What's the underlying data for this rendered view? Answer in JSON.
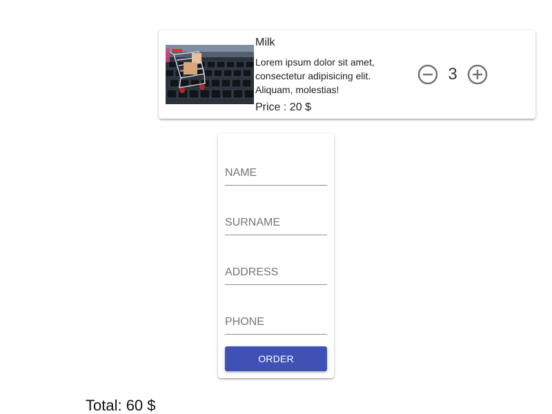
{
  "cart": {
    "items": [
      {
        "name": "Milk",
        "description": "Lorem ipsum dolor sit amet, consectetur adipisicing elit. Aliquam, molestias!",
        "price_text": "Price : 20 $",
        "quantity": "3",
        "image_icon": "shopping-cart-on-laptop-keyboard-image"
      }
    ],
    "minus_icon": "minus-circle-icon",
    "plus_icon": "plus-circle-icon"
  },
  "form": {
    "name_placeholder": "NAME",
    "surname_placeholder": "SURNAME",
    "address_placeholder": "ADDRESS",
    "phone_placeholder": "PHONE",
    "name_value": "",
    "surname_value": "",
    "address_value": "",
    "phone_value": "",
    "submit_label": "ORDER"
  },
  "summary": {
    "total_text": "Total: 60 $"
  },
  "colors": {
    "primary": "#3f51b5",
    "icon_gray": "#757575",
    "input_underline": "#8c8c8c"
  }
}
